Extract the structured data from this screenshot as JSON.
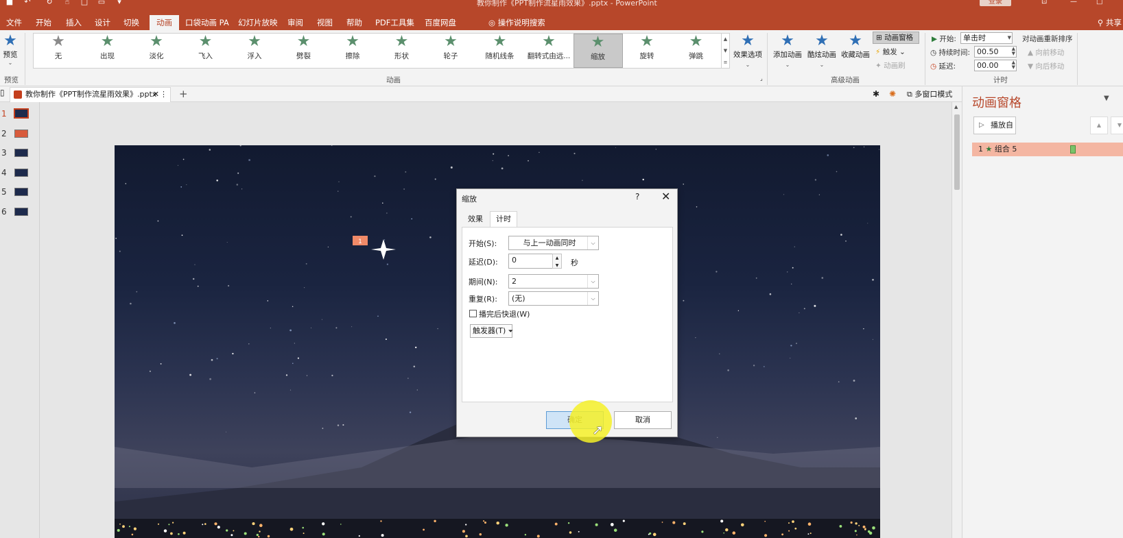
{
  "window": {
    "title": "教你制作《PPT制作流星雨效果》.pptx - PowerPoint",
    "login_label": "登录"
  },
  "menu": {
    "items": [
      "文件",
      "开始",
      "插入",
      "设计",
      "切换",
      "动画",
      "口袋动画 PA",
      "幻灯片放映",
      "审阅",
      "视图",
      "帮助",
      "PDF工具集",
      "百度网盘"
    ],
    "active": "动画",
    "search_tip": "操作说明搜索",
    "share": "共享"
  },
  "ribbon": {
    "preview_label": "预览",
    "preview_group": "预览",
    "animation_group": "动画",
    "advanced_group": "高级动画",
    "timing_group": "计时",
    "gallery": [
      {
        "label": "无",
        "icon": "star-gray-icon"
      },
      {
        "label": "出现",
        "icon": "star-appear-icon"
      },
      {
        "label": "淡化",
        "icon": "star-fade-icon"
      },
      {
        "label": "飞入",
        "icon": "star-fly-in-icon"
      },
      {
        "label": "浮入",
        "icon": "star-float-in-icon"
      },
      {
        "label": "劈裂",
        "icon": "star-split-icon"
      },
      {
        "label": "擦除",
        "icon": "star-wipe-icon"
      },
      {
        "label": "形状",
        "icon": "star-shape-icon"
      },
      {
        "label": "轮子",
        "icon": "star-wheel-icon"
      },
      {
        "label": "随机线条",
        "icon": "star-random-bars-icon"
      },
      {
        "label": "翻转式由远...",
        "icon": "star-grow-turn-icon"
      },
      {
        "label": "缩放",
        "icon": "star-zoom-icon"
      },
      {
        "label": "旋转",
        "icon": "star-swivel-icon"
      },
      {
        "label": "弹跳",
        "icon": "star-bounce-icon"
      }
    ],
    "selected_effect": "缩放",
    "effect_options": "效果选项",
    "add_animation": "添加动画",
    "cool_animation": "酷炫动画",
    "fav_animation": "收藏动画",
    "animation_pane": "动画窗格",
    "trigger": "触发",
    "animation_painter": "动画刷",
    "start_label": "开始:",
    "start_value": "单击时",
    "duration_label": "持续时间:",
    "duration_value": "00.50",
    "delay_label": "延迟:",
    "delay_value": "00.00",
    "reorder_label": "对动画重新排序",
    "move_earlier": "向前移动",
    "move_later": "向后移动"
  },
  "docbar": {
    "tab_label": "教你制作《PPT制作流星雨效果》.pptx",
    "multiwindow": "多窗口模式"
  },
  "slides": {
    "numbers": [
      "1",
      "2",
      "3",
      "4",
      "5",
      "6"
    ],
    "selected": "1"
  },
  "slide": {
    "anim_tag": "1"
  },
  "pane": {
    "title": "动画窗格",
    "play_from": "播放自",
    "item_number": "1",
    "item_name": "组合 5"
  },
  "dialog": {
    "title": "缩放",
    "help": "?",
    "tabs": [
      "效果",
      "计时"
    ],
    "active_tab": "计时",
    "start_label": "开始(S):",
    "start_value": "与上一动画同时",
    "delay_label": "延迟(D):",
    "delay_value": "0",
    "delay_unit": "秒",
    "duration_label": "期间(N):",
    "duration_value": "2",
    "repeat_label": "重复(R):",
    "repeat_value": "(无)",
    "rewind_label": "播完后快退(W)",
    "rewind_checked": false,
    "trigger_label": "触发器(T)",
    "ok_label": "确定",
    "cancel_label": "取消"
  },
  "colors": {
    "accent": "#b7472a",
    "selected_item": "#f4b6a2",
    "highlight": "#f5f028"
  }
}
